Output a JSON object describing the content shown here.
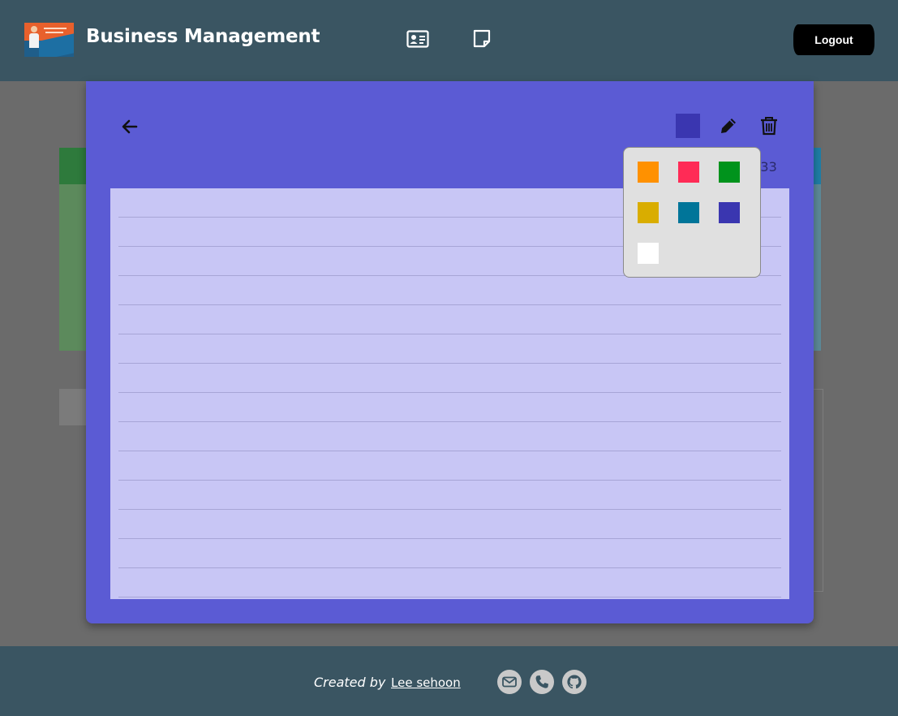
{
  "header": {
    "title": "Business Management",
    "logo_icon": "business-card-logo",
    "nav_icons": [
      "contact-card-icon",
      "sticky-note-icon"
    ],
    "logout_label": "Logout"
  },
  "note_modal": {
    "time_fragment": ":33",
    "current_color": "#3a36b0",
    "background_color": "#5b5bd4",
    "paper_color": "#c8c6f5",
    "icons": [
      "back-arrow-icon",
      "pencil-icon",
      "trash-icon"
    ]
  },
  "color_picker": {
    "colors": [
      "#ff9100",
      "#ff2b56",
      "#00931c",
      "#d9ad00",
      "#007599",
      "#3a36b0",
      "#ffffff"
    ]
  },
  "footer": {
    "created_by": "Created by",
    "author": "Lee sehoon",
    "icons": [
      "email-icon",
      "phone-icon",
      "github-icon"
    ]
  }
}
